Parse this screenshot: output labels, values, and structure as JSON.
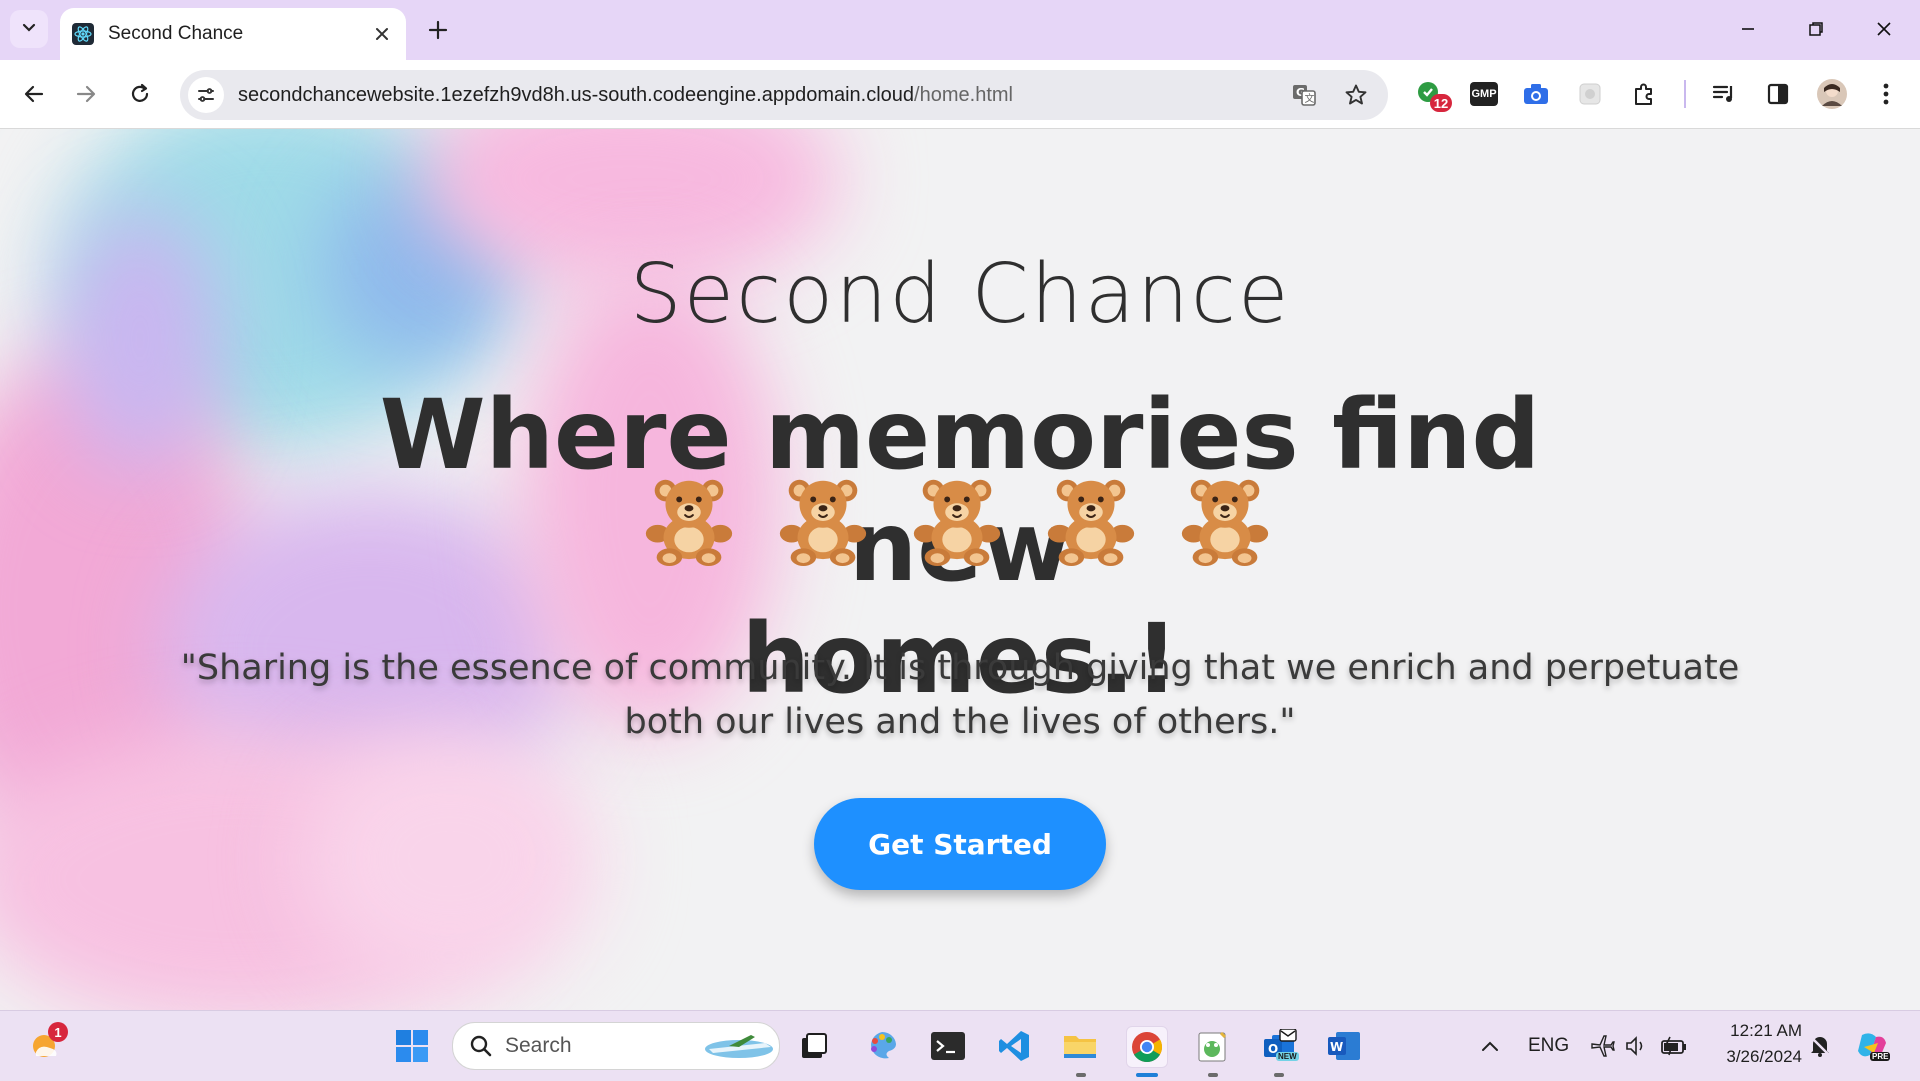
{
  "browser": {
    "tab_title": "Second Chance",
    "url_host": "secondchancewebsite.1ezefzh9vd8h.us-south.codeengine.appdomain.cloud",
    "url_path": "/home.html",
    "extension_badge": "12",
    "gmp_label": "GMP"
  },
  "page": {
    "brand": "Second Chance",
    "headline_line1": "Where memories find new",
    "headline_line2": "homes.!",
    "quote_line1": "\"Sharing is the essence of community. It is through giving that we enrich and perpetuate",
    "quote_line2": "both our lives and the lives of others.\"",
    "cta_label": "Get Started",
    "bear_count": 5
  },
  "taskbar": {
    "weather_badge": "1",
    "search_placeholder": "Search",
    "language": "ENG",
    "time": "12:21 AM",
    "date": "3/26/2024",
    "outlook_badge": "NEW",
    "copilot_badge": "PRE"
  },
  "colors": {
    "tabstrip": "#e6d6f7",
    "cta": "#1e90ff",
    "text_dark": "#2f2f2f"
  }
}
